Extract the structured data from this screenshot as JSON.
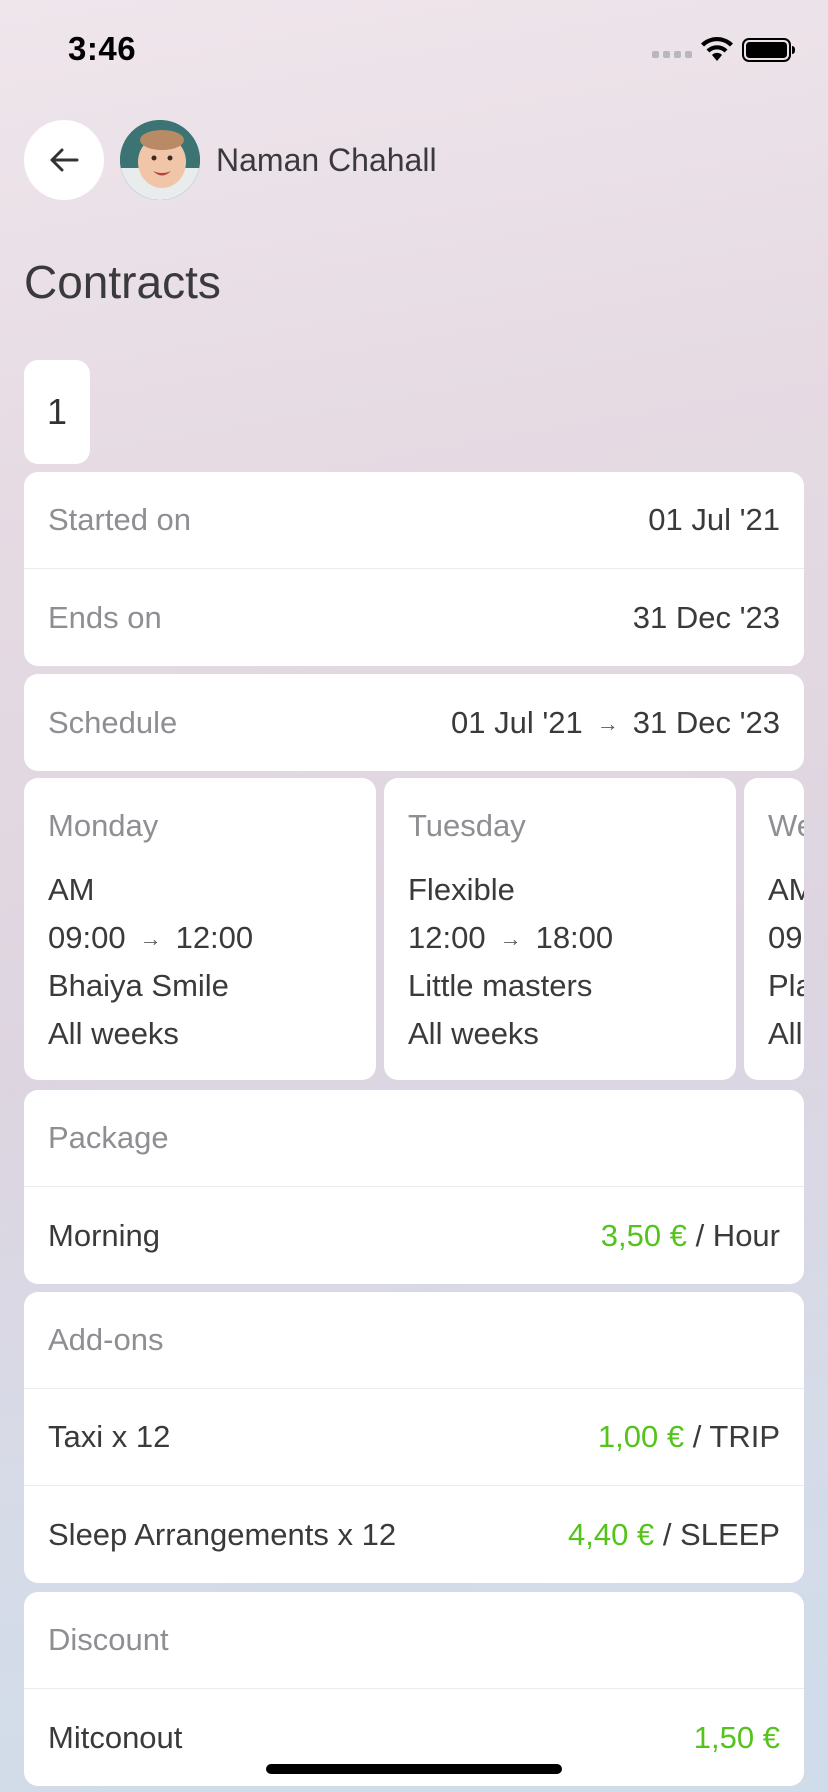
{
  "status": {
    "time": "3:46"
  },
  "header": {
    "user_name": "Naman Chahall",
    "title": "Contracts"
  },
  "contract_tab": "1",
  "dates": {
    "started_label": "Started on",
    "started_value": "01 Jul '21",
    "ends_label": "Ends on",
    "ends_value": "31 Dec '23"
  },
  "schedule": {
    "label": "Schedule",
    "from": "01 Jul '21",
    "arrow": "→",
    "to": "31 Dec '23",
    "days": [
      {
        "day": "Monday",
        "slot": "AM",
        "start": "09:00",
        "end": "12:00",
        "place": "Bhaiya Smile",
        "weeks": "All weeks"
      },
      {
        "day": "Tuesday",
        "slot": "Flexible",
        "start": "12:00",
        "end": "18:00",
        "place": "Little masters",
        "weeks": "All weeks"
      },
      {
        "day": "We",
        "slot": "AM",
        "start": "09",
        "end": "",
        "place": "Pla",
        "weeks": "All"
      }
    ]
  },
  "package": {
    "label": "Package",
    "name": "Morning",
    "price": "3,50 €",
    "unit": "/ Hour"
  },
  "addons": {
    "label": "Add-ons",
    "items": [
      {
        "name": "Taxi x 12",
        "price": "1,00 €",
        "unit": "/ TRIP"
      },
      {
        "name": "Sleep Arrangements x 12",
        "price": "4,40 €",
        "unit": "/ SLEEP"
      }
    ]
  },
  "discount": {
    "label": "Discount",
    "name": "Mitconout",
    "price": "1,50 €"
  },
  "colors": {
    "price_green": "#54c41c",
    "muted": "#8e8e93"
  }
}
